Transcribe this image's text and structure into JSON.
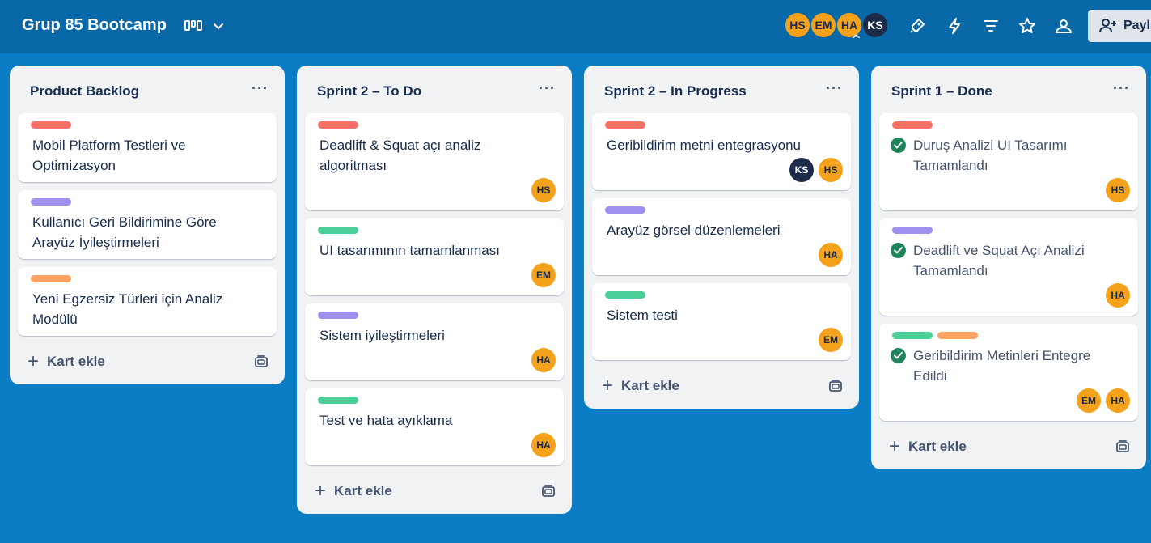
{
  "header": {
    "board_title": "Grup 85 Bootcamp",
    "members": [
      {
        "initials": "HS",
        "color": "#f4a11c"
      },
      {
        "initials": "EM",
        "color": "#f4a11c"
      },
      {
        "initials": "HA",
        "color": "#f4a11c"
      },
      {
        "initials": "KS",
        "color": "#1d2b4b"
      }
    ],
    "icons": [
      "power-ups-icon",
      "automation-icon",
      "filter-icon",
      "star-icon",
      "visibility-icon"
    ],
    "share_label": "Payl"
  },
  "lists": [
    {
      "title": "Product Backlog",
      "add_label": "Kart ekle",
      "cards": [
        {
          "label": "red",
          "text": "Mobil Platform Testleri ve Optimizasyon"
        },
        {
          "label": "purple",
          "text": "Kullanıcı Geri Bildirimine Göre Arayüz İyileştirmeleri"
        },
        {
          "label": "orange",
          "text": "Yeni Egzersiz Türleri için Analiz Modülü"
        }
      ]
    },
    {
      "title": "Sprint 2 – To Do",
      "add_label": "Kart ekle",
      "cards": [
        {
          "label": "red",
          "text": "Deadlift & Squat açı analiz algoritması",
          "members": [
            "HS"
          ]
        },
        {
          "label": "green",
          "text": "UI tasarımının tamamlanması",
          "members": [
            "EM"
          ]
        },
        {
          "label": "purple",
          "text": "Sistem iyileştirmeleri",
          "members": [
            "HA"
          ]
        },
        {
          "label": "green",
          "text": "Test ve hata ayıklama",
          "members": [
            "HA"
          ]
        }
      ]
    },
    {
      "title": "Sprint 2 – In Progress",
      "add_label": "Kart ekle",
      "cards": [
        {
          "label": "red",
          "text": "Geribildirim metni entegrasyonu",
          "members": [
            "KS",
            "HS"
          ]
        },
        {
          "label": "purple",
          "text": "Arayüz görsel düzenlemeleri",
          "members": [
            "HA"
          ]
        },
        {
          "label": "green",
          "text": "Sistem testi",
          "members": [
            "EM"
          ]
        }
      ]
    },
    {
      "title": "Sprint 1 – Done",
      "add_label": "Kart ekle",
      "cards": [
        {
          "label": "red",
          "text": "Duruş Analizi UI Tasarımı Tamamlandı",
          "members": [
            "HS"
          ],
          "done": true
        },
        {
          "label": "purple",
          "text": "Deadlift ve Squat Açı Analizi Tamamlandı",
          "members": [
            "HA"
          ],
          "done": true
        },
        {
          "labels": [
            "green",
            "orange"
          ],
          "text": "Geribildirim Metinleri Entegre Edildi",
          "members": [
            "EM",
            "HA"
          ],
          "done": true
        }
      ]
    }
  ]
}
